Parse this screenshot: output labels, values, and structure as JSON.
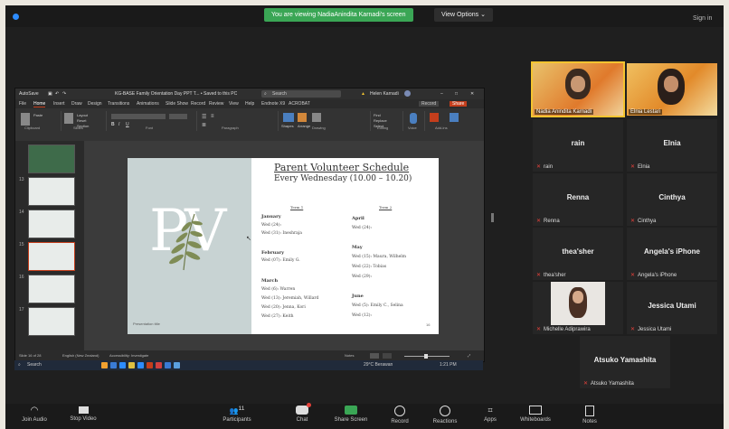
{
  "top_banner": {
    "viewing_text": "You are viewing NadiaAnindita Karnadi's screen",
    "view_options": "View Options",
    "sign_in": "Sign in"
  },
  "ppt": {
    "autosave": "AutoSave",
    "file_title": "KG-BASE Family Orientation Day PPT T... • Saved to this PC",
    "search": "Search",
    "user": "Helen Karnadi",
    "tabs": [
      "File",
      "Home",
      "Insert",
      "Draw",
      "Design",
      "Transitions",
      "Animations",
      "Slide Show",
      "Record",
      "Review",
      "View",
      "Help",
      "Endnote X9",
      "ACROBAT"
    ],
    "record_btn": "Record",
    "share_btn": "Share",
    "ribbon_groups": [
      "Clipboard",
      "Slides",
      "Font",
      "Paragraph",
      "Drawing",
      "Editing",
      "Voice",
      "Add-ins"
    ],
    "ribbon_items": [
      "Paste",
      "New Slide",
      "Layout",
      "Reset",
      "Section",
      "Shapes",
      "Arrange",
      "Quick Styles",
      "Find",
      "Replace",
      "Select",
      "Dictate",
      "Add-ins",
      "Designer"
    ],
    "status": {
      "slide_count": "Slide 16 of 28",
      "language": "English (New Zealand)",
      "accessibility": "Accessibility: Investigate",
      "notes": "Notes"
    },
    "thumb_numbers": [
      "",
      "13",
      "14",
      "15",
      "16",
      "17",
      "18"
    ]
  },
  "slide": {
    "monogram": "PV",
    "title": "Parent Volunteer Schedule",
    "subtitle": "Every Wednesday (10.00 – 10.20)",
    "term1": "Term 1",
    "term2": "Term 2",
    "footer": "Presentation title",
    "page": "16",
    "term1_months": [
      {
        "month": "January",
        "entries": [
          "Wed (24):",
          "Wed (31): Ineshraja"
        ]
      },
      {
        "month": "February",
        "entries": [
          "Wed (07): Emily G."
        ]
      },
      {
        "month": "March",
        "entries": [
          "Wed (6): Warren",
          "Wed (13): Jeremiah, Willard",
          "Wed (20): Jenna, Kori",
          "Wed (27): Keith"
        ]
      }
    ],
    "term2_months": [
      {
        "month": "April",
        "entries": [
          "Wed (24):"
        ]
      },
      {
        "month": "May",
        "entries": [
          "Wed (15): Maura, Wilhelm",
          "Wed (22): Tobias",
          "Wed (29):"
        ]
      },
      {
        "month": "June",
        "entries": [
          "Wed (5): Emily C., Selina",
          "Wed (12):"
        ]
      }
    ]
  },
  "taskbar": {
    "search": "Search",
    "weather": "29°C Berawan",
    "time": "1:21 PM"
  },
  "participants": [
    {
      "name": "Nadia Anindita Karnadi",
      "video": true
    },
    {
      "name": "Elnia Lestari",
      "video": true
    },
    {
      "name": "rain",
      "label": "rain"
    },
    {
      "name": "Elnia",
      "label": "Elnia"
    },
    {
      "name": "Renna",
      "label": "Renna"
    },
    {
      "name": "Cinthya",
      "label": "Cinthya"
    },
    {
      "name": "thea'sher",
      "label": "thea'sher"
    },
    {
      "name": "Angela's iPhone",
      "label": "Angela's iPhone"
    },
    {
      "name": "Michelle Adiprawira",
      "video": true
    },
    {
      "name": "Jessica Utami",
      "label": "Jessica Utami"
    },
    {
      "name": "Atsuko Yamashita",
      "label": "Atsuko Yamashita"
    }
  ],
  "controls": {
    "join_audio": "Join Audio",
    "stop_video": "Stop Video",
    "participants": "Participants",
    "participants_count": "11",
    "chat": "Chat",
    "share_screen": "Share Screen",
    "record": "Record",
    "reactions": "Reactions",
    "apps": "Apps",
    "whiteboards": "Whiteboards",
    "notes": "Notes"
  },
  "colors": {
    "banner_green": "#3aa655",
    "mic_muted_red": "#e5413a",
    "ppt_accent": "#c43e1c",
    "slide_panel": "#c8d3d3"
  }
}
